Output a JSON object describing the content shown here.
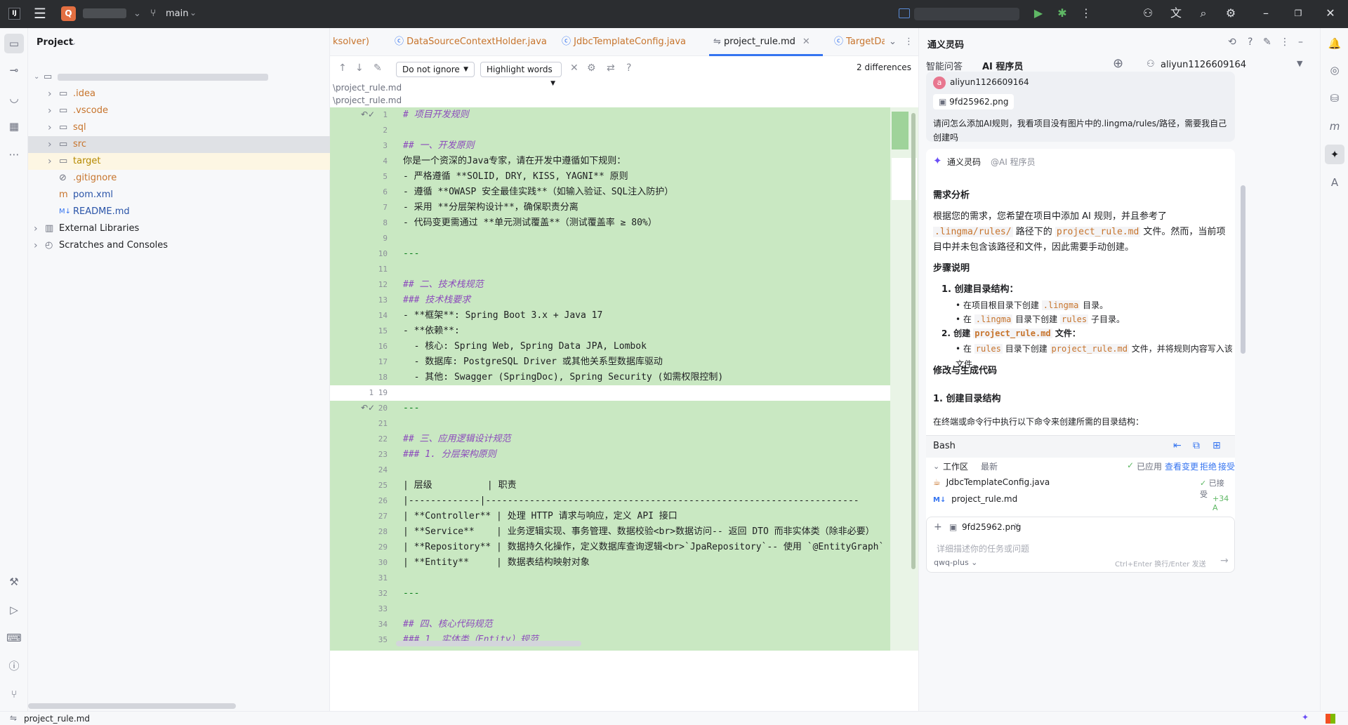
{
  "titlebar": {
    "logo": "IJ",
    "project_badge": "Q",
    "branch": "main",
    "colors": {
      "bg": "#2b2d30",
      "badge": "#e36f41"
    }
  },
  "project_panel": {
    "title": "Project",
    "items": [
      {
        "label": ".idea",
        "type": "folder"
      },
      {
        "label": ".vscode",
        "type": "folder"
      },
      {
        "label": "sql",
        "type": "folder"
      },
      {
        "label": "src",
        "type": "folder",
        "selected": true
      },
      {
        "label": "target",
        "type": "folder",
        "ignored": true
      },
      {
        "label": ".gitignore",
        "type": "file"
      },
      {
        "label": "pom.xml",
        "type": "file"
      },
      {
        "label": "README.md",
        "type": "file"
      },
      {
        "label": "External Libraries",
        "type": "root"
      },
      {
        "label": "Scratches and Consoles",
        "type": "root"
      }
    ]
  },
  "editor": {
    "tabs": [
      {
        "label": "ksolver)"
      },
      {
        "label": "DataSourceContextHolder.java"
      },
      {
        "label": "JdbcTemplateConfig.java"
      },
      {
        "label": "project_rule.md",
        "active": true
      },
      {
        "label": "TargetDat"
      }
    ],
    "diff": {
      "ignore_option": "Do not ignore",
      "highlight_option": "Highlight words",
      "differences": "2 differences",
      "path1": "\\project_rule.md",
      "path2": "\\project_rule.md"
    },
    "lines": [
      {
        "n": "1",
        "text": "# 项目开发规则",
        "kind": "h"
      },
      {
        "n": "2",
        "text": "",
        "kind": "p"
      },
      {
        "n": "3",
        "text": "## 一、开发原则",
        "kind": "h"
      },
      {
        "n": "4",
        "text": "你是一个资深的Java专家，请在开发中遵循如下规则：",
        "kind": "p"
      },
      {
        "n": "5",
        "text": "- 严格遵循 **SOLID, DRY, KISS, YAGNI** 原则",
        "kind": "b"
      },
      {
        "n": "6",
        "text": "- 遵循 **OWASP 安全最佳实践**（如输入验证、SQL注入防护）",
        "kind": "b"
      },
      {
        "n": "7",
        "text": "- 采用 **分层架构设计**，确保职责分离",
        "kind": "b"
      },
      {
        "n": "8",
        "text": "- 代码变更需通过 **单元测试覆盖**（测试覆盖率 ≥ 80%）",
        "kind": "b"
      },
      {
        "n": "9",
        "text": "",
        "kind": "p"
      },
      {
        "n": "10",
        "text": "---",
        "kind": "c"
      },
      {
        "n": "11",
        "text": "",
        "kind": "p"
      },
      {
        "n": "12",
        "text": "## 二、技术栈规范",
        "kind": "h"
      },
      {
        "n": "13",
        "text": "### 技术栈要求",
        "kind": "h"
      },
      {
        "n": "14",
        "text": "- **框架**: Spring Boot 3.x + Java 17",
        "kind": "b"
      },
      {
        "n": "15",
        "text": "- **依赖**:",
        "kind": "b"
      },
      {
        "n": "16",
        "text": "  - 核心: Spring Web, Spring Data JPA, Lombok",
        "kind": "p"
      },
      {
        "n": "17",
        "text": "  - 数据库: PostgreSQL Driver 或其他关系型数据库驱动",
        "kind": "p"
      },
      {
        "n": "18",
        "text": "  - 其他: Swagger (SpringDoc), Spring Security (如需权限控制)",
        "kind": "p"
      },
      {
        "n": "1 19",
        "text": "",
        "kind": "blank"
      },
      {
        "n": "20",
        "text": "---",
        "kind": "c"
      },
      {
        "n": "21",
        "text": "",
        "kind": "p"
      },
      {
        "n": "22",
        "text": "## 三、应用逻辑设计规范",
        "kind": "h"
      },
      {
        "n": "23",
        "text": "### 1. 分层架构原则",
        "kind": "h"
      },
      {
        "n": "24",
        "text": "",
        "kind": "p"
      },
      {
        "n": "25",
        "text": "| 层级          | 职责",
        "kind": "t"
      },
      {
        "n": "26",
        "text": "|-------------|--------------------------------------------------------------------",
        "kind": "t"
      },
      {
        "n": "27",
        "text": "| **Controller** | 处理 HTTP 请求与响应，定义 API 接口",
        "kind": "t"
      },
      {
        "n": "28",
        "text": "| **Service**    | 业务逻辑实现、事务管理、数据校验<br>数据访问-- 返回 DTO 而非实体类（除非必要）",
        "kind": "t"
      },
      {
        "n": "29",
        "text": "| **Repository** | 数据持久化操作，定义数据库查询逻辑<br>`JpaRepository`-- 使用 `@EntityGraph`",
        "kind": "t"
      },
      {
        "n": "30",
        "text": "| **Entity**     | 数据表结构映射对象",
        "kind": "t"
      },
      {
        "n": "31",
        "text": "",
        "kind": "p"
      },
      {
        "n": "32",
        "text": "---",
        "kind": "c"
      },
      {
        "n": "33",
        "text": "",
        "kind": "p"
      },
      {
        "n": "34",
        "text": "## 四、核心代码规范",
        "kind": "h"
      },
      {
        "n": "35",
        "text": "### 1. 实体类（Entity）规范",
        "kind": "h"
      }
    ]
  },
  "ai_panel": {
    "title": "通义灵码",
    "tabs": [
      "智能问答",
      "AI 程序员"
    ],
    "user": "aliyun1126609164",
    "user_avatar": "a",
    "attachment": "9fd25962.png",
    "question": "请问怎么添加AI规则，我看项目没有图片中的.lingma/rules/路径，需要我自己创建吗",
    "bot_name": "通义灵码",
    "bot_role": "@AI 程序员",
    "answer": {
      "h_analysis": "需求分析",
      "analysis_p1": "根据您的需求，您希望在项目中添加 AI 规则，并且参考了",
      "analysis_code1": ".lingma/rules/",
      "analysis_p2": "路径下的",
      "analysis_code2": "project_rule.md",
      "analysis_p3": "文件。然而，当前项目中并未包含该路径和文件，因此需要手动创建。",
      "h_steps": "步骤说明",
      "step1": "1. 创建目录结构：",
      "step1_a_pre": "在项目根目录下创建",
      "step1_a_code": ".lingma",
      "step1_a_post": "目录。",
      "step1_b_pre": "在",
      "step1_b_code": ".lingma",
      "step1_b_mid": "目录下创建",
      "step1_b_code2": "rules",
      "step1_b_post": "子目录。",
      "step2_pre": "2. 创建",
      "step2_code": "project_rule.md",
      "step2_post": "文件：",
      "step2_a_pre": "在",
      "step2_a_code": "rules",
      "step2_a_mid": "目录下创建",
      "step2_a_code2": "project_rule.md",
      "step2_a_post": "文件，并将规则内容写入该文件。",
      "h_modify": "修改与生成代码",
      "h_create": "1. 创建目录结构",
      "create_p": "在终端或命令行中执行以下命令来创建所需的目录结构：",
      "code_lang": "Bash"
    },
    "workspace": {
      "title": "工作区",
      "filter": "最新",
      "applied": "已应用",
      "view_changes": "查看变更",
      "reject": "拒绝",
      "accept": "接受",
      "files": [
        {
          "name": "JdbcTemplateConfig.java",
          "status": "已接受"
        },
        {
          "name": "project_rule.md",
          "status": "+34 A"
        }
      ]
    },
    "input": {
      "attachment": "9fd25962.png",
      "placeholder": "详细描述你的任务或问题",
      "model": "qwq-plus",
      "hint": "Ctrl+Enter 换行/Enter 发送"
    }
  },
  "statusbar": {
    "file": "project_rule.md"
  },
  "colors": {
    "diff_green": "#c9e8c2",
    "accent": "#3574f0",
    "code_orange": "#c7742c"
  }
}
